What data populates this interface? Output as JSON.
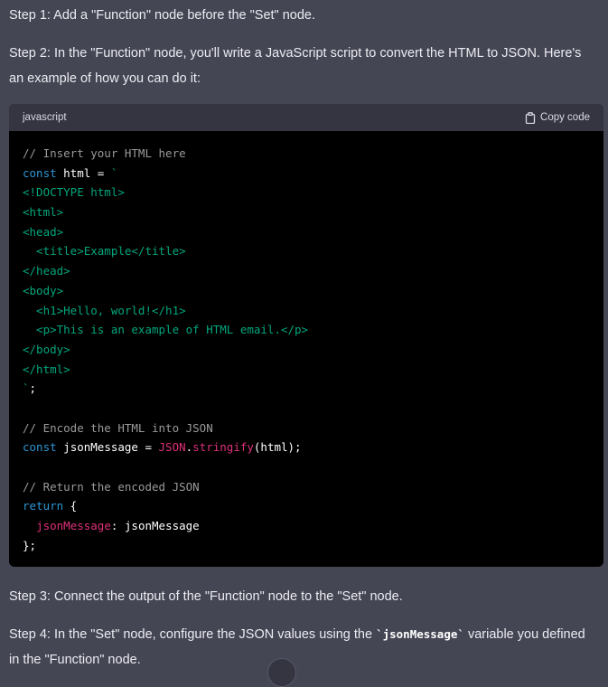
{
  "message": {
    "step1": "Step 1: Add a \"Function\" node before the \"Set\" node.",
    "step2": "Step 2: In the \"Function\" node, you'll write a JavaScript script to convert the HTML to JSON. Here's an example of how you can do it:",
    "step3": "Step 3: Connect the output of the \"Function\" node to the \"Set\" node.",
    "step4_before": "Step 4: In the \"Set\" node, configure the JSON values using the ",
    "step4_code": "`jsonMessage`",
    "step4_after": " variable you defined in the \"Function\" node."
  },
  "code_block": {
    "language": "javascript",
    "copy_label": "Copy code",
    "lines": [
      [
        [
          "comment",
          "// Insert your HTML here"
        ]
      ],
      [
        [
          "kw",
          "const"
        ],
        [
          "plain",
          " html = "
        ],
        [
          "str",
          "`"
        ]
      ],
      [
        [
          "str",
          "<!DOCTYPE html>"
        ]
      ],
      [
        [
          "str",
          "<html>"
        ]
      ],
      [
        [
          "str",
          "<head>"
        ]
      ],
      [
        [
          "str",
          "  <title>Example</title>"
        ]
      ],
      [
        [
          "str",
          "</head>"
        ]
      ],
      [
        [
          "str",
          "<body>"
        ]
      ],
      [
        [
          "str",
          "  <h1>Hello, world!</h1>"
        ]
      ],
      [
        [
          "str",
          "  <p>This is an example of HTML email.</p>"
        ]
      ],
      [
        [
          "str",
          "</body>"
        ]
      ],
      [
        [
          "str",
          "</html>"
        ]
      ],
      [
        [
          "str",
          "`"
        ],
        [
          "plain",
          ";"
        ]
      ],
      [
        [
          "plain",
          ""
        ]
      ],
      [
        [
          "comment",
          "// Encode the HTML into JSON"
        ]
      ],
      [
        [
          "kw",
          "const"
        ],
        [
          "plain",
          " jsonMessage = "
        ],
        [
          "prop",
          "JSON"
        ],
        [
          "plain",
          "."
        ],
        [
          "prop",
          "stringify"
        ],
        [
          "plain",
          "(html);"
        ]
      ],
      [
        [
          "plain",
          ""
        ]
      ],
      [
        [
          "comment",
          "// Return the encoded JSON"
        ]
      ],
      [
        [
          "kw",
          "return"
        ],
        [
          "plain",
          " {"
        ]
      ],
      [
        [
          "plain",
          "  "
        ],
        [
          "prop",
          "jsonMessage"
        ],
        [
          "plain",
          ": jsonMessage"
        ]
      ],
      [
        [
          "plain",
          "};"
        ]
      ]
    ]
  },
  "icons": {
    "copy": "clipboard-icon"
  },
  "colors": {
    "background": "#444654",
    "code_bg": "#000000",
    "code_header_bg": "#343541",
    "keyword": "#2e95d3",
    "string": "#00a67d",
    "property": "#df3079",
    "comment": "#9a9a9a"
  }
}
